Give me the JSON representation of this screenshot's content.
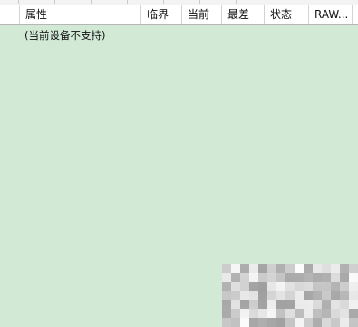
{
  "table": {
    "columns": [
      "",
      "属性",
      "临界",
      "当前",
      "最差",
      "状态",
      "RAW...",
      ""
    ]
  },
  "status": {
    "message": "(当前设备不支持)"
  },
  "colors": {
    "background": "#d2e9d6",
    "header_background": "#ffffff",
    "header_border": "#b5b5b5"
  }
}
